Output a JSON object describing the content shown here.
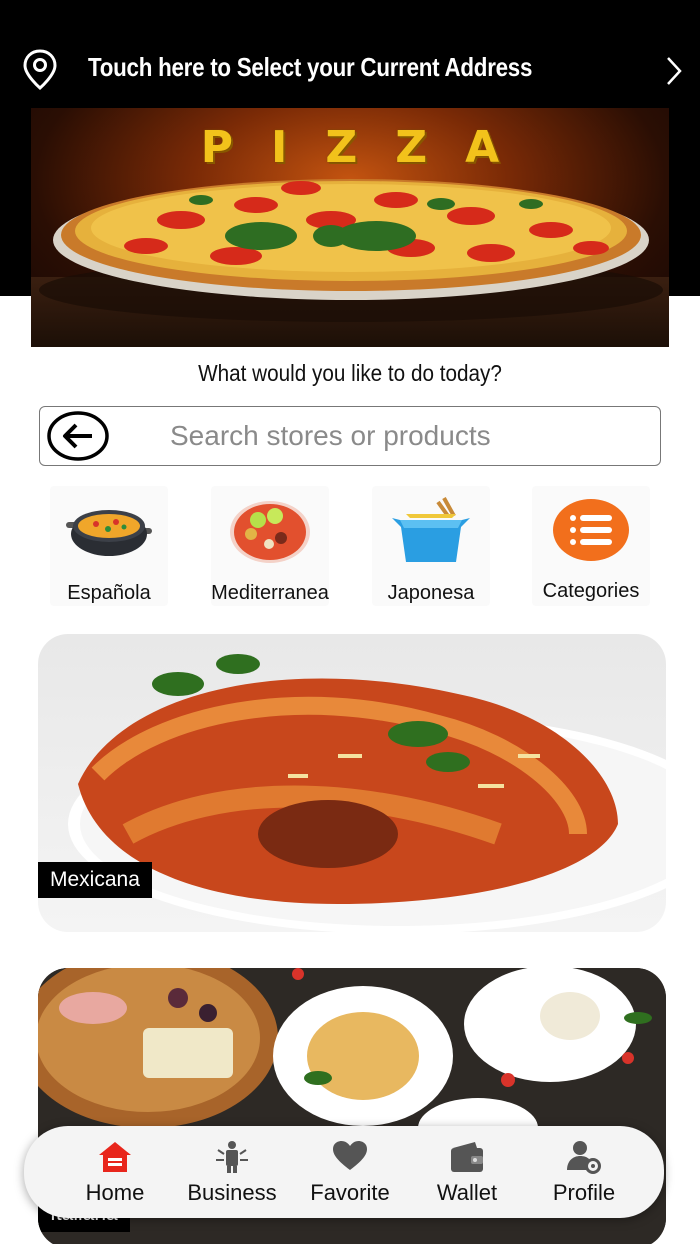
{
  "header": {
    "address_prompt": "Touch here to Select your Current Address",
    "pin_icon": "location-pin-icon",
    "chevron_icon": "chevron-right-icon"
  },
  "banner": {
    "title": "PIZZA"
  },
  "prompt": "What would you like to do today?",
  "search": {
    "placeholder": "Search stores or products",
    "value": ""
  },
  "categories": [
    {
      "label": "Española",
      "icon": "paella-pan-icon"
    },
    {
      "label": "Mediterranea",
      "icon": "salad-bowl-icon"
    },
    {
      "label": "Japonesa",
      "icon": "noodle-box-icon"
    },
    {
      "label": "Categories",
      "icon": "list-menu-icon"
    }
  ],
  "cards": [
    {
      "tag": "Mexicana"
    },
    {
      "tag": "Italiana"
    }
  ],
  "nav": {
    "active_color": "#e8261c",
    "items": [
      {
        "label": "Home",
        "icon": "home-icon",
        "active": true
      },
      {
        "label": "Business",
        "icon": "business-person-icon",
        "active": false
      },
      {
        "label": "Favorite",
        "icon": "heart-icon",
        "active": false
      },
      {
        "label": "Wallet",
        "icon": "wallet-icon",
        "active": false
      },
      {
        "label": "Profile",
        "icon": "profile-settings-icon",
        "active": false
      }
    ]
  }
}
